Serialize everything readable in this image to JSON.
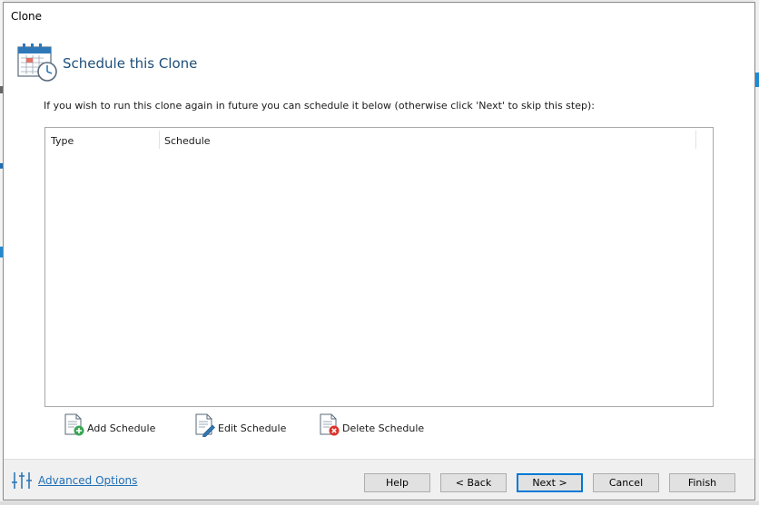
{
  "window": {
    "title": "Clone"
  },
  "header": {
    "title": "Schedule this Clone",
    "icon": "calendar-clock-icon"
  },
  "instruction": "If you wish to run this clone again in future you can schedule it below (otherwise click 'Next' to skip this step):",
  "grid": {
    "columns": [
      "Type",
      "Schedule"
    ],
    "rows": []
  },
  "schedule_actions": {
    "add": "Add Schedule",
    "edit": "Edit Schedule",
    "delete": "Delete Schedule"
  },
  "footer": {
    "advanced_options": "Advanced Options",
    "buttons": {
      "help": "Help",
      "back": "< Back",
      "next": "Next >",
      "cancel": "Cancel",
      "finish": "Finish"
    }
  },
  "colors": {
    "accent": "#0078d7",
    "title_blue": "#1e4f7a",
    "link": "#1f6fb7",
    "add_green": "#3aa655",
    "delete_red": "#d9342b"
  }
}
